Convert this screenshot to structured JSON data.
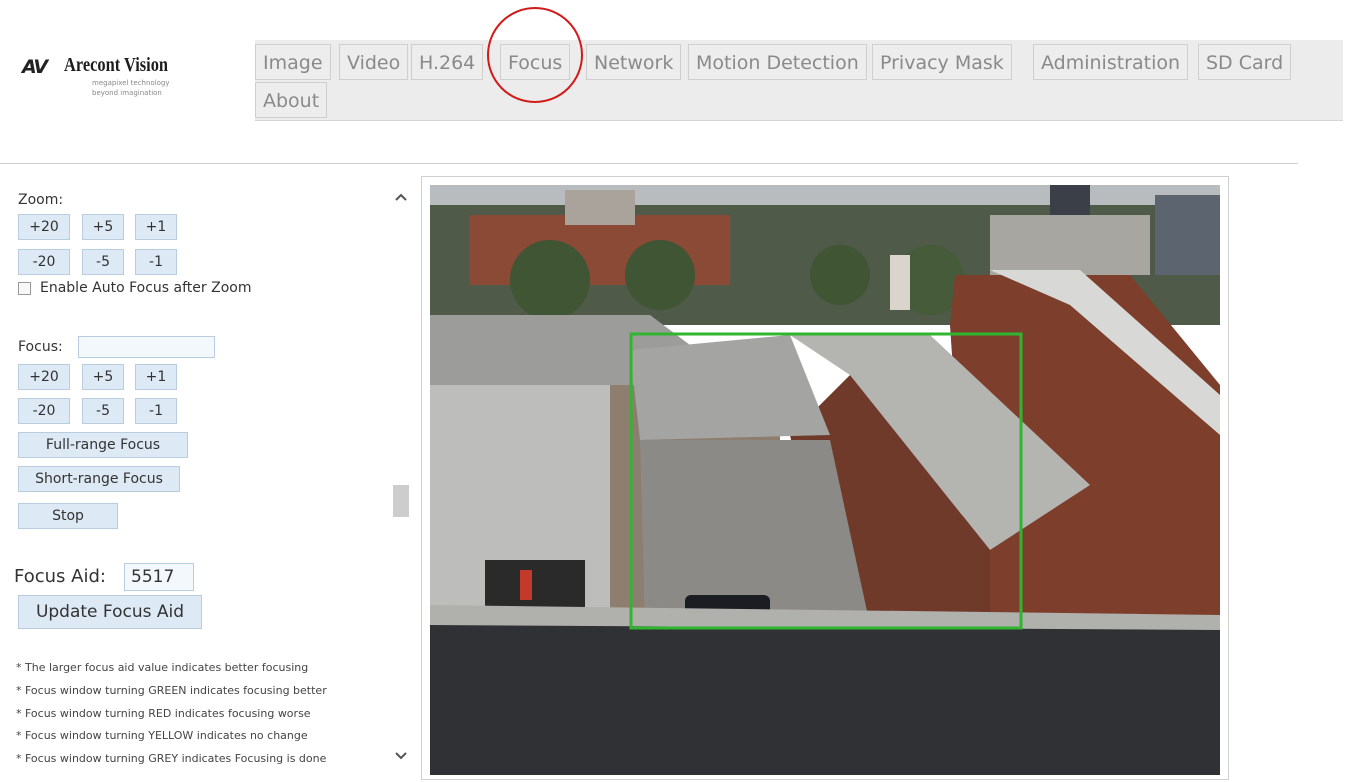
{
  "logo": {
    "mark": "AV",
    "name": "Arecont Vision",
    "tagline1": "megapixel technology",
    "tagline2": "beyond imagination"
  },
  "tabs": [
    "Image",
    "Video",
    "H.264",
    "Focus",
    "Network",
    "Motion Detection",
    "Privacy Mask",
    "Administration",
    "SD Card",
    "About"
  ],
  "active_tab": "Focus",
  "highlight_color": "#d21a1a",
  "zoom": {
    "label": "Zoom:",
    "plus": [
      "+20",
      "+5",
      "+1"
    ],
    "minus": [
      "-20",
      "-5",
      "-1"
    ],
    "auto_focus_label": "Enable Auto Focus after Zoom",
    "auto_focus_checked": false
  },
  "focus": {
    "label": "Focus:",
    "value": "",
    "plus": [
      "+20",
      "+5",
      "+1"
    ],
    "minus": [
      "-20",
      "-5",
      "-1"
    ],
    "full_range": "Full-range Focus",
    "short_range": "Short-range Focus",
    "stop": "Stop"
  },
  "focus_aid": {
    "label": "Focus Aid:",
    "value": "5517",
    "update": "Update Focus Aid"
  },
  "notes": [
    "* The larger focus aid value indicates better focusing",
    "* Focus window turning GREEN indicates focusing better",
    "* Focus window turning RED indicates focusing worse",
    "* Focus window turning YELLOW indicates no change",
    "* Focus window turning GREY indicates Focusing is done"
  ],
  "focus_window_color": "#2fb52f",
  "icons": {
    "scroll_up": "chevron-up-icon",
    "scroll_down": "chevron-down-icon"
  }
}
